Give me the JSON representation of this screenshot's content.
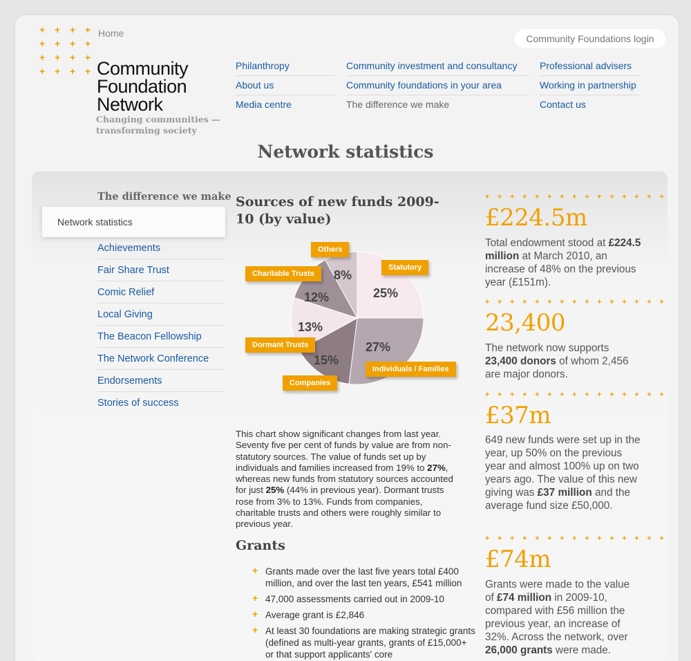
{
  "header": {
    "home": "Home",
    "login": "Community Foundations login",
    "logo_lines": [
      "Community",
      "Foundation",
      "Network"
    ],
    "tagline_lines": [
      "Changing communities —",
      "transforming society"
    ]
  },
  "nav": {
    "col1": [
      "Philanthropy",
      "About us",
      "Media centre"
    ],
    "col2": [
      "Community investment and consultancy",
      "Community foundations in your area",
      "The difference we make"
    ],
    "col3": [
      "Professional advisers",
      "Working in partnership",
      "Contact us"
    ]
  },
  "page_title": "Network statistics",
  "sidebar": {
    "heading": "The difference we make",
    "active": "Network statistics",
    "items": [
      "Achievements",
      "Fair Share Trust",
      "Comic Relief",
      "Local Giving",
      "The Beacon Fellowship",
      "The Network Conference",
      "Endorsements",
      "Stories of success"
    ]
  },
  "chart_title": "Sources of new funds 2009-10 (by value)",
  "chart_data": {
    "type": "pie",
    "title": "Sources of new funds 2009-10 (by value)",
    "slices": [
      {
        "label": "Statutory",
        "value": 25,
        "display": "25%",
        "color": "#f7e9ee"
      },
      {
        "label": "Individuals / Families",
        "value": 27,
        "display": "27%",
        "color": "#b5a7af"
      },
      {
        "label": "Companies",
        "value": 15,
        "display": "15%",
        "color": "#8d7d83"
      },
      {
        "label": "Dormant Trusts",
        "value": 13,
        "display": "13%",
        "color": "#f2e6ea"
      },
      {
        "label": "Charitable Trusts",
        "value": 12,
        "display": "12%",
        "color": "#9f8f96"
      },
      {
        "label": "Others",
        "value": 8,
        "display": "8%",
        "color": "#d3c6cc"
      }
    ]
  },
  "description": {
    "p1": "This chart show significant changes from last year. Seventy five per cent of funds by value are from non-statutory sources. The value of funds set up by individuals and families increased from 19% to ",
    "b1": "27%",
    "p2": ", whereas new funds from statutory sources accounted for just ",
    "b2": "25%",
    "p3": " (44% in previous year). Dormant trusts rose from 3% to 13%. Funds from companies, charitable trusts and others were roughly similar to previous year."
  },
  "grants": {
    "title": "Grants",
    "bullets": [
      "Grants made over the last five years total £400 million, and over the last ten years, £541 million",
      "47,000 assessments carried out in 2009-10",
      "Average grant is £2,846",
      "At least 30 foundations are making strategic grants (defined as multi-year grants, grants of £15,000+ or that support applicants' core"
    ]
  },
  "stats": {
    "plus_row": "+++++++++++++++",
    "s1": {
      "big": "£224.5m",
      "t1": "Total endowment stood at ",
      "b1": "£224.5 million",
      "t2": " at March 2010, an increase of 48% on the previous year (£151m)."
    },
    "s2": {
      "big": "23,400",
      "t1": "The network now supports ",
      "b1": "23,400 donors",
      "t2": " of whom 2,456 are major donors."
    },
    "s3": {
      "big": "£37m",
      "t1": "649 new funds were set up in the year, up 50% on the previous year and almost 100% up on two years ago. The value of this new giving was ",
      "b1": "£37 million",
      "t2": " and the average fund size £50,000."
    },
    "s4": {
      "big": "£74m",
      "t1": "Grants were made to the value of ",
      "b1": "£74 million",
      "t2": " in 2009-10, compared with £56 million the previous year, an increase of 32%. Across the network, over ",
      "b2": "26,000 grants",
      "t3": " were made."
    }
  },
  "colors": {
    "accent": "#f0a000",
    "link": "#1a5aa0"
  }
}
